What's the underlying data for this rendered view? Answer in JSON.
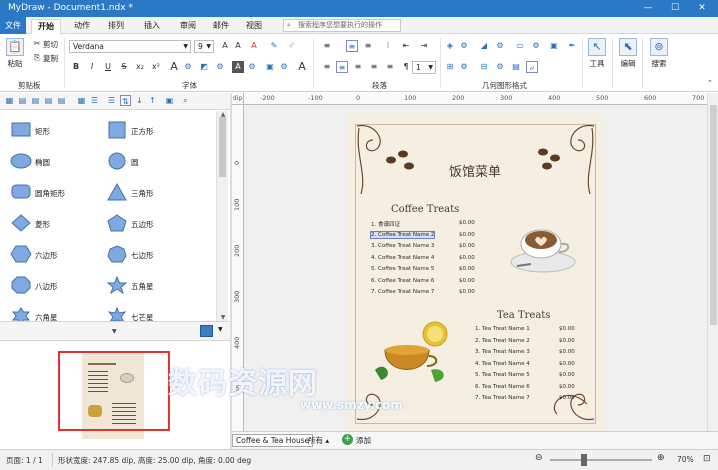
{
  "window": {
    "title": "MyDraw - Document1.ndx *",
    "controls": [
      "—",
      "☐",
      "✕"
    ]
  },
  "tabs": {
    "file": "文件",
    "home": "开始",
    "animation": "动作",
    "arrange": "排列",
    "insert": "插入",
    "review": "审阅",
    "mail": "邮件",
    "view": "视图",
    "tellme": "搜索程序您想要执行的操作"
  },
  "ribbon": {
    "paste": "粘贴",
    "cut": "剪切",
    "copy": "复制",
    "clipboard": "剪贴板",
    "font_name": "Verdana",
    "font_size": "9",
    "font": "字体",
    "paragraph": "段落",
    "geometry": "几何图形格式",
    "line_spacing": "1",
    "tools": "工具",
    "edit": "编辑",
    "search": "搜索"
  },
  "shapes": [
    {
      "label": "矩形",
      "kind": "rect"
    },
    {
      "label": "正方形",
      "kind": "square"
    },
    {
      "label": "椭圆",
      "kind": "ellipse"
    },
    {
      "label": "圆",
      "kind": "circle"
    },
    {
      "label": "圆角矩形",
      "kind": "roundrect"
    },
    {
      "label": "三角形",
      "kind": "triangle"
    },
    {
      "label": "菱形",
      "kind": "diamond"
    },
    {
      "label": "五边形",
      "kind": "pentagon"
    },
    {
      "label": "六边形",
      "kind": "hexagon"
    },
    {
      "label": "七边形",
      "kind": "heptagon"
    },
    {
      "label": "八边形",
      "kind": "octagon"
    },
    {
      "label": "五角星",
      "kind": "star5"
    },
    {
      "label": "六角星",
      "kind": "star6"
    },
    {
      "label": "七芒星",
      "kind": "star7"
    }
  ],
  "ruler": {
    "unit": "dip",
    "h": [
      "-200",
      "-100",
      "0",
      "100",
      "200",
      "300",
      "400",
      "500",
      "600",
      "700"
    ],
    "v": [
      "0",
      "100",
      "200",
      "300",
      "400",
      "500"
    ]
  },
  "menu": {
    "title": "饭馆菜单",
    "coffee_title": "Coffee Treats",
    "coffee_items": [
      {
        "name": "1. 食谱四证",
        "price": "$0.00"
      },
      {
        "name": "2. Coffee Treat Name 2",
        "price": "$0.00"
      },
      {
        "name": "3. Coffee Treat Name 3",
        "price": "$0.00"
      },
      {
        "name": "4. Coffee Treat Name 4",
        "price": "$0.00"
      },
      {
        "name": "5. Coffee Treat Name 5",
        "price": "$0.00"
      },
      {
        "name": "6. Coffee Treat Name 6",
        "price": "$0.00"
      },
      {
        "name": "7. Coffee Treat Name 7",
        "price": "$0.00"
      }
    ],
    "tea_title": "Tea Treats",
    "tea_items": [
      {
        "name": "1. Tea Treat Name 1",
        "price": "$0.00"
      },
      {
        "name": "2. Tea Treat Name 2",
        "price": "$0.00"
      },
      {
        "name": "3. Tea Treat Name 3",
        "price": "$0.00"
      },
      {
        "name": "4. Tea Treat Name 4",
        "price": "$0.00"
      },
      {
        "name": "5. Tea Treat Name 5",
        "price": "$0.00"
      },
      {
        "name": "6. Tea Treat Name 6",
        "price": "$0.00"
      },
      {
        "name": "7. Tea Treat Name 7",
        "price": "$0.00"
      }
    ]
  },
  "pagetabs": {
    "current": "Coffee & Tea House",
    "all": "所有 ▴",
    "add": "添加"
  },
  "status": {
    "page": "页面: 1 / 1",
    "shape": "形状宽度: 247.85 dip, 高度: 25.00 dip, 角度: 0.00 deg",
    "zoom": "70%"
  },
  "watermark": {
    "main": "数码资源网",
    "url": "www.smzy.com"
  }
}
